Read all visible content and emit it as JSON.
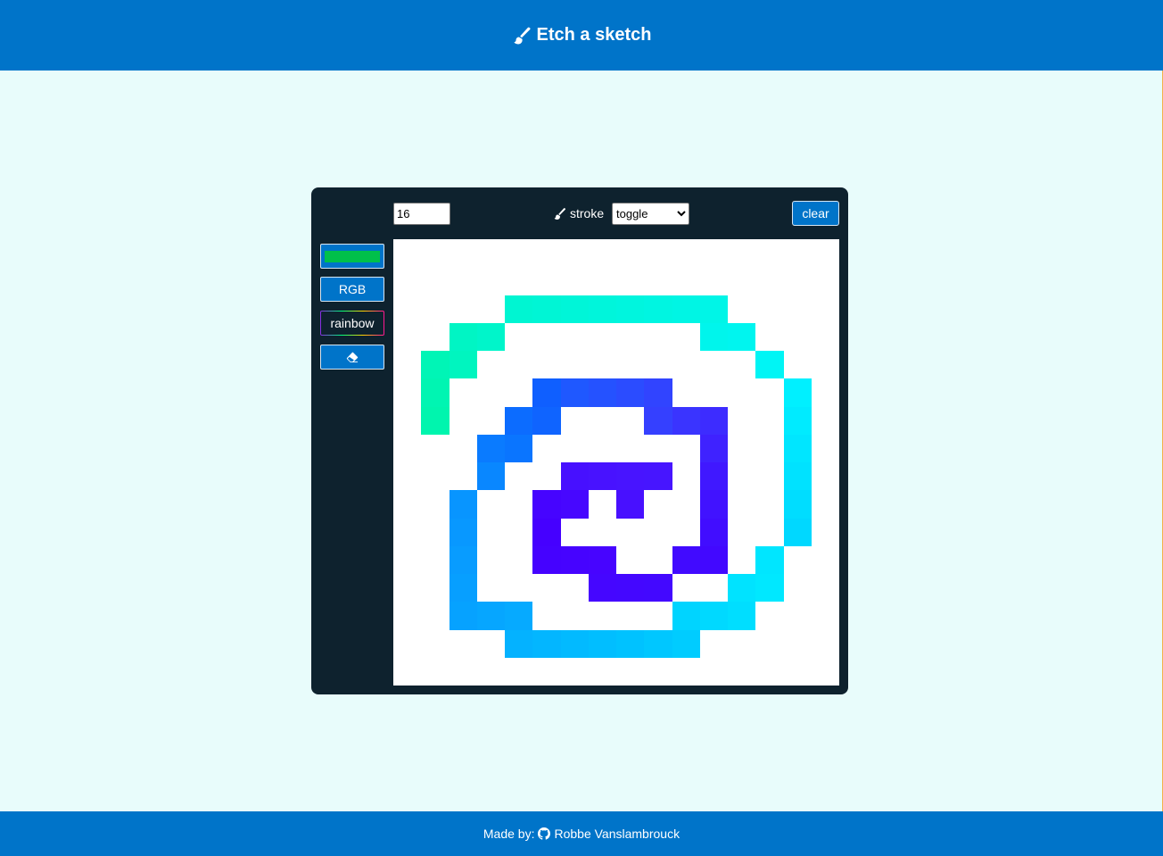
{
  "header": {
    "title": "Etch a sketch",
    "icon": "paint-brush-icon"
  },
  "controls": {
    "grid_size": "16",
    "stroke_label": "stroke",
    "stroke_mode": "toggle",
    "stroke_options": [
      "toggle"
    ],
    "clear_label": "clear",
    "color_value": "#00c04a",
    "rgb_label": "RGB",
    "rainbow_label": "rainbow",
    "eraser_icon": "eraser-icon"
  },
  "footer": {
    "made_by_label": "Made by:",
    "author": "Robbe Vanslambrouck",
    "icon": "github-icon"
  },
  "grid": {
    "size": 16,
    "cells": [
      {
        "r": 2,
        "c": 4,
        "color": "#00f5d2"
      },
      {
        "r": 2,
        "c": 5,
        "color": "#00f5d5"
      },
      {
        "r": 2,
        "c": 6,
        "color": "#00f5d8"
      },
      {
        "r": 2,
        "c": 7,
        "color": "#00f5db"
      },
      {
        "r": 2,
        "c": 8,
        "color": "#00f5de"
      },
      {
        "r": 2,
        "c": 9,
        "color": "#00f5e1"
      },
      {
        "r": 2,
        "c": 10,
        "color": "#00f5e4"
      },
      {
        "r": 2,
        "c": 11,
        "color": "#00f5e7"
      },
      {
        "r": 3,
        "c": 2,
        "color": "#00f5c4"
      },
      {
        "r": 3,
        "c": 3,
        "color": "#00f5ca"
      },
      {
        "r": 3,
        "c": 11,
        "color": "#00f5ec"
      },
      {
        "r": 3,
        "c": 12,
        "color": "#00f5ef"
      },
      {
        "r": 4,
        "c": 1,
        "color": "#00f5b6"
      },
      {
        "r": 4,
        "c": 2,
        "color": "#00f5bf"
      },
      {
        "r": 4,
        "c": 13,
        "color": "#00f5f5"
      },
      {
        "r": 5,
        "c": 1,
        "color": "#00f5b2"
      },
      {
        "r": 5,
        "c": 5,
        "color": "#0f5fff"
      },
      {
        "r": 5,
        "c": 6,
        "color": "#1f58ff"
      },
      {
        "r": 5,
        "c": 7,
        "color": "#2552ff"
      },
      {
        "r": 5,
        "c": 8,
        "color": "#2b4cff"
      },
      {
        "r": 5,
        "c": 9,
        "color": "#3144ff"
      },
      {
        "r": 5,
        "c": 14,
        "color": "#00f0ff"
      },
      {
        "r": 6,
        "c": 1,
        "color": "#00f5ae"
      },
      {
        "r": 6,
        "c": 4,
        "color": "#0c6cff"
      },
      {
        "r": 6,
        "c": 5,
        "color": "#0f64ff"
      },
      {
        "r": 6,
        "c": 9,
        "color": "#3540ff"
      },
      {
        "r": 6,
        "c": 10,
        "color": "#3a34ff"
      },
      {
        "r": 6,
        "c": 11,
        "color": "#3d2cff"
      },
      {
        "r": 6,
        "c": 14,
        "color": "#00ebff"
      },
      {
        "r": 7,
        "c": 3,
        "color": "#0a7bff"
      },
      {
        "r": 7,
        "c": 4,
        "color": "#0a75ff"
      },
      {
        "r": 7,
        "c": 11,
        "color": "#3f22ff"
      },
      {
        "r": 7,
        "c": 14,
        "color": "#00e6ff"
      },
      {
        "r": 8,
        "c": 3,
        "color": "#0987ff"
      },
      {
        "r": 8,
        "c": 6,
        "color": "#4710ff"
      },
      {
        "r": 8,
        "c": 7,
        "color": "#4812ff"
      },
      {
        "r": 8,
        "c": 8,
        "color": "#4814ff"
      },
      {
        "r": 8,
        "c": 9,
        "color": "#4715ff"
      },
      {
        "r": 8,
        "c": 11,
        "color": "#4018ff"
      },
      {
        "r": 8,
        "c": 14,
        "color": "#00e2ff"
      },
      {
        "r": 9,
        "c": 2,
        "color": "#0895ff"
      },
      {
        "r": 9,
        "c": 5,
        "color": "#4604ff"
      },
      {
        "r": 9,
        "c": 6,
        "color": "#4707ff"
      },
      {
        "r": 9,
        "c": 8,
        "color": "#4810ff"
      },
      {
        "r": 9,
        "c": 11,
        "color": "#4112ff"
      },
      {
        "r": 9,
        "c": 14,
        "color": "#00ddff"
      },
      {
        "r": 10,
        "c": 2,
        "color": "#0898ff"
      },
      {
        "r": 10,
        "c": 5,
        "color": "#4500ff"
      },
      {
        "r": 10,
        "c": 11,
        "color": "#410dff"
      },
      {
        "r": 10,
        "c": 14,
        "color": "#00d8ff"
      },
      {
        "r": 11,
        "c": 2,
        "color": "#089cff"
      },
      {
        "r": 11,
        "c": 5,
        "color": "#4502ff"
      },
      {
        "r": 11,
        "c": 6,
        "color": "#4603ff"
      },
      {
        "r": 11,
        "c": 7,
        "color": "#4704ff"
      },
      {
        "r": 11,
        "c": 10,
        "color": "#410aff"
      },
      {
        "r": 11,
        "c": 11,
        "color": "#4208ff"
      },
      {
        "r": 11,
        "c": 13,
        "color": "#00e6ff"
      },
      {
        "r": 12,
        "c": 2,
        "color": "#079fff"
      },
      {
        "r": 12,
        "c": 7,
        "color": "#4506ff"
      },
      {
        "r": 12,
        "c": 8,
        "color": "#4407ff"
      },
      {
        "r": 12,
        "c": 9,
        "color": "#4308ff"
      },
      {
        "r": 12,
        "c": 12,
        "color": "#00e3ff"
      },
      {
        "r": 12,
        "c": 13,
        "color": "#00e8ff"
      },
      {
        "r": 13,
        "c": 2,
        "color": "#06a2ff"
      },
      {
        "r": 13,
        "c": 3,
        "color": "#06a6ff"
      },
      {
        "r": 13,
        "c": 4,
        "color": "#06aaff"
      },
      {
        "r": 13,
        "c": 10,
        "color": "#00d4ff"
      },
      {
        "r": 13,
        "c": 11,
        "color": "#00d9ff"
      },
      {
        "r": 13,
        "c": 12,
        "color": "#00deff"
      },
      {
        "r": 14,
        "c": 4,
        "color": "#04b2ff"
      },
      {
        "r": 14,
        "c": 5,
        "color": "#03b6ff"
      },
      {
        "r": 14,
        "c": 6,
        "color": "#02baff"
      },
      {
        "r": 14,
        "c": 7,
        "color": "#01beff"
      },
      {
        "r": 14,
        "c": 8,
        "color": "#00c2ff"
      },
      {
        "r": 14,
        "c": 9,
        "color": "#00c7ff"
      },
      {
        "r": 14,
        "c": 10,
        "color": "#00ccff"
      }
    ]
  }
}
